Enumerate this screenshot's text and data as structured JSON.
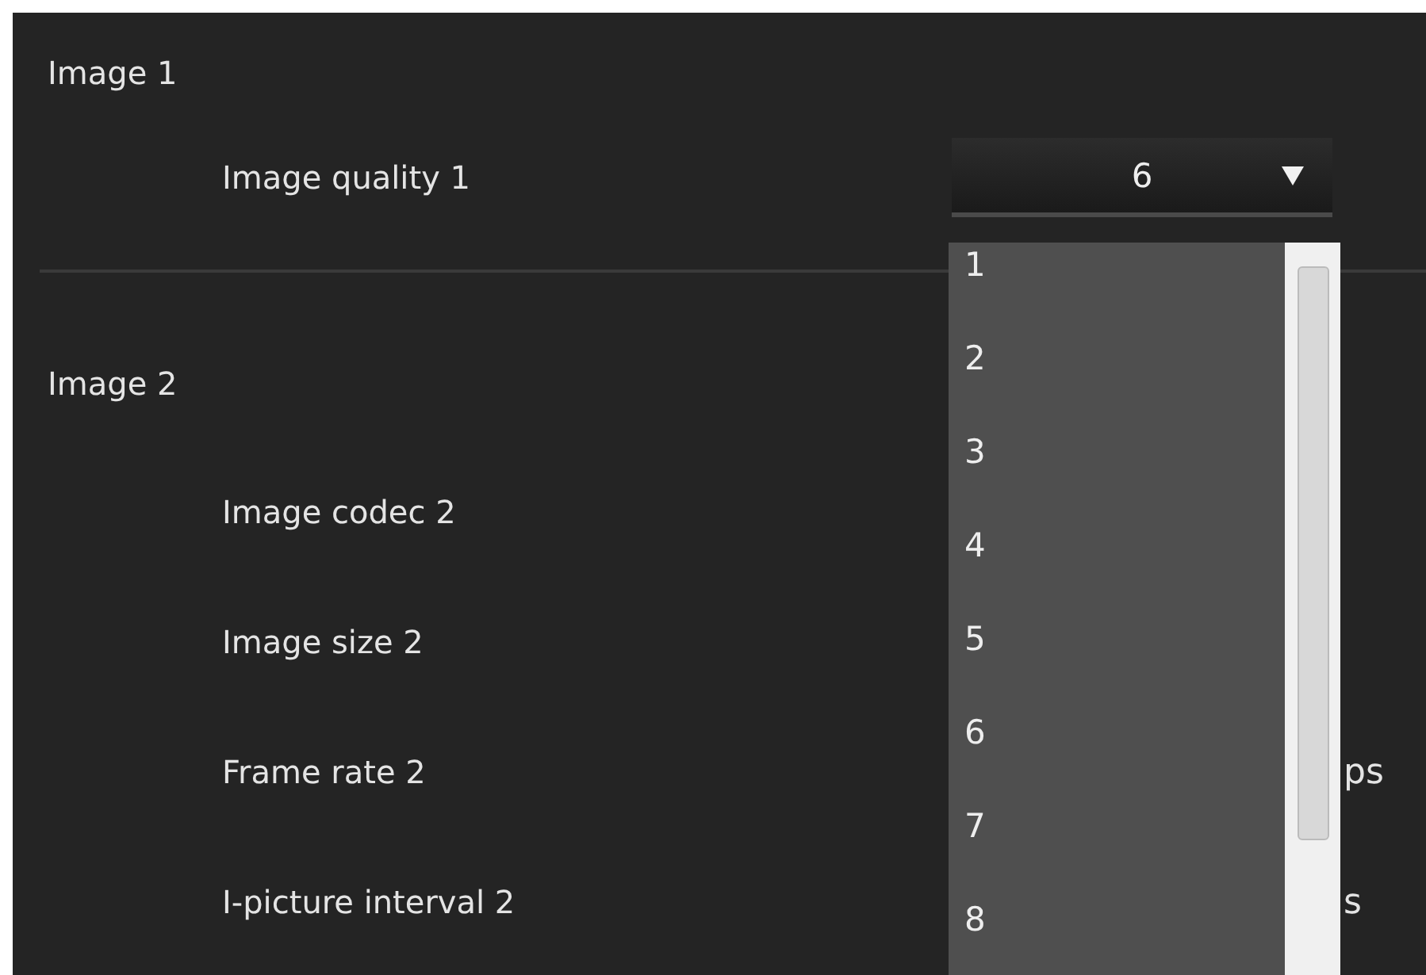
{
  "sections": [
    {
      "title": "Image 1",
      "rows": [
        {
          "label": "Image quality 1",
          "kind": "dropdown",
          "value": "6"
        }
      ]
    },
    {
      "title": "Image 2",
      "rows": [
        {
          "label": "Image codec 2",
          "kind": "plain"
        },
        {
          "label": "Image size 2",
          "kind": "plain"
        },
        {
          "label": "Frame rate 2",
          "kind": "unit",
          "unit": "ps"
        },
        {
          "label": "I-picture interval 2",
          "kind": "unit",
          "unit": "s"
        }
      ]
    }
  ],
  "dropdown_list": {
    "options": [
      "1",
      "2",
      "3",
      "4",
      "5",
      "6",
      "7",
      "8"
    ]
  }
}
